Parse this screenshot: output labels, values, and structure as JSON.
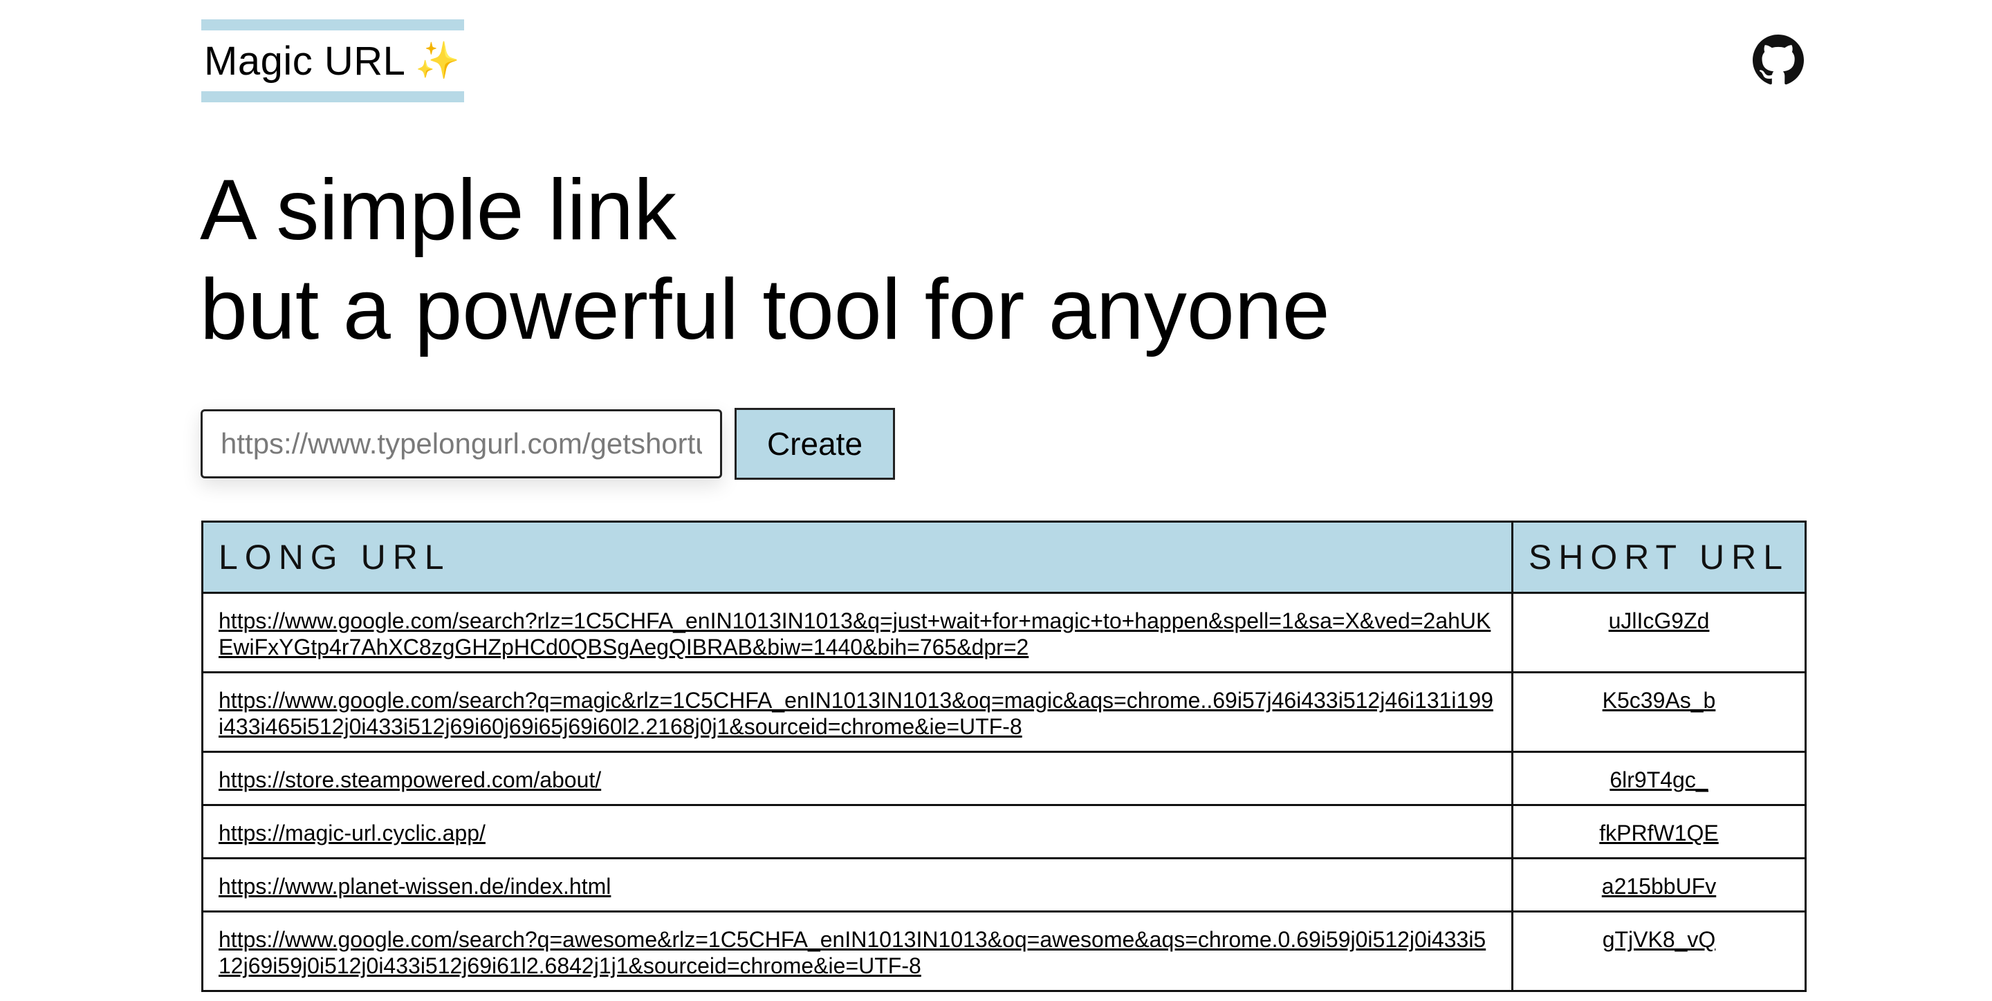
{
  "brand": {
    "name": "Magic URL",
    "sparkle": "✨"
  },
  "header": {
    "github_icon": "github-icon"
  },
  "hero": {
    "line1": "A simple link",
    "line2": "but a powerful tool for anyone"
  },
  "form": {
    "placeholder": "https://www.typelongurl.com/getshorturl",
    "value": "",
    "create_label": "Create"
  },
  "table": {
    "headers": {
      "long": "LONG URL",
      "short": "SHORT URL"
    },
    "rows": [
      {
        "long": "https://www.google.com/search?rlz=1C5CHFA_enIN1013IN1013&q=just+wait+for+magic+to+happen&spell=1&sa=X&ved=2ahUKEwiFxYGtp4r7AhXC8zgGHZpHCd0QBSgAegQIBRAB&biw=1440&bih=765&dpr=2",
        "short": "uJlIcG9Zd"
      },
      {
        "long": "https://www.google.com/search?q=magic&rlz=1C5CHFA_enIN1013IN1013&oq=magic&aqs=chrome..69i57j46i433i512j46i131i199i433i465i512j0i433i512j69i60j69i65j69i60l2.2168j0j1&sourceid=chrome&ie=UTF-8",
        "short": "K5c39As_b"
      },
      {
        "long": "https://store.steampowered.com/about/",
        "short": "6lr9T4gc_"
      },
      {
        "long": "https://magic-url.cyclic.app/",
        "short": "fkPRfW1QE"
      },
      {
        "long": "https://www.planet-wissen.de/index.html",
        "short": "a215bbUFv"
      },
      {
        "long": "https://www.google.com/search?q=awesome&rlz=1C5CHFA_enIN1013IN1013&oq=awesome&aqs=chrome.0.69i59j0i512j0i433i512j69i59j0i512j0i433i512j69i61l2.6842j1j1&sourceid=chrome&ie=UTF-8",
        "short": "gTjVK8_vQ"
      }
    ]
  },
  "colors": {
    "accent": "#b7d9e6",
    "text": "#000000",
    "border": "#111111",
    "sparkle": "#f2c94c"
  }
}
